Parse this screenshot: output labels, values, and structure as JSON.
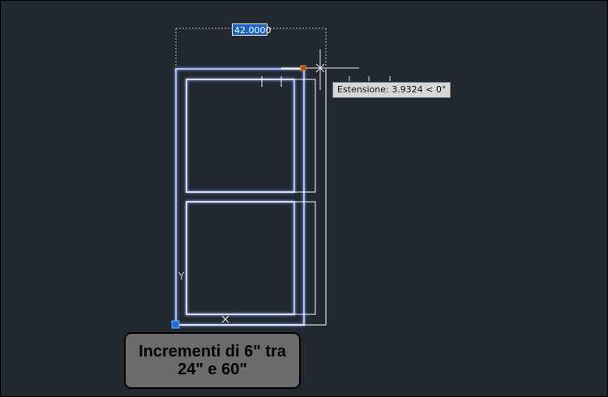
{
  "drawing": {
    "dimension_value": "42.0000",
    "extension_tooltip": "Estensione: 3.9324 < 0°",
    "ucs_y_label": "Y",
    "colors": {
      "background": "#212830",
      "selected_geometry": "#9fb4ff",
      "geometry": "#ffffff",
      "dimension_line": "#b8b8b8",
      "grip": "#1e6fd9",
      "endpoint_marker": "#c0392b"
    }
  },
  "caption": {
    "line1": "Incrementi di 6\" tra",
    "line2": "24\" e 60\""
  }
}
